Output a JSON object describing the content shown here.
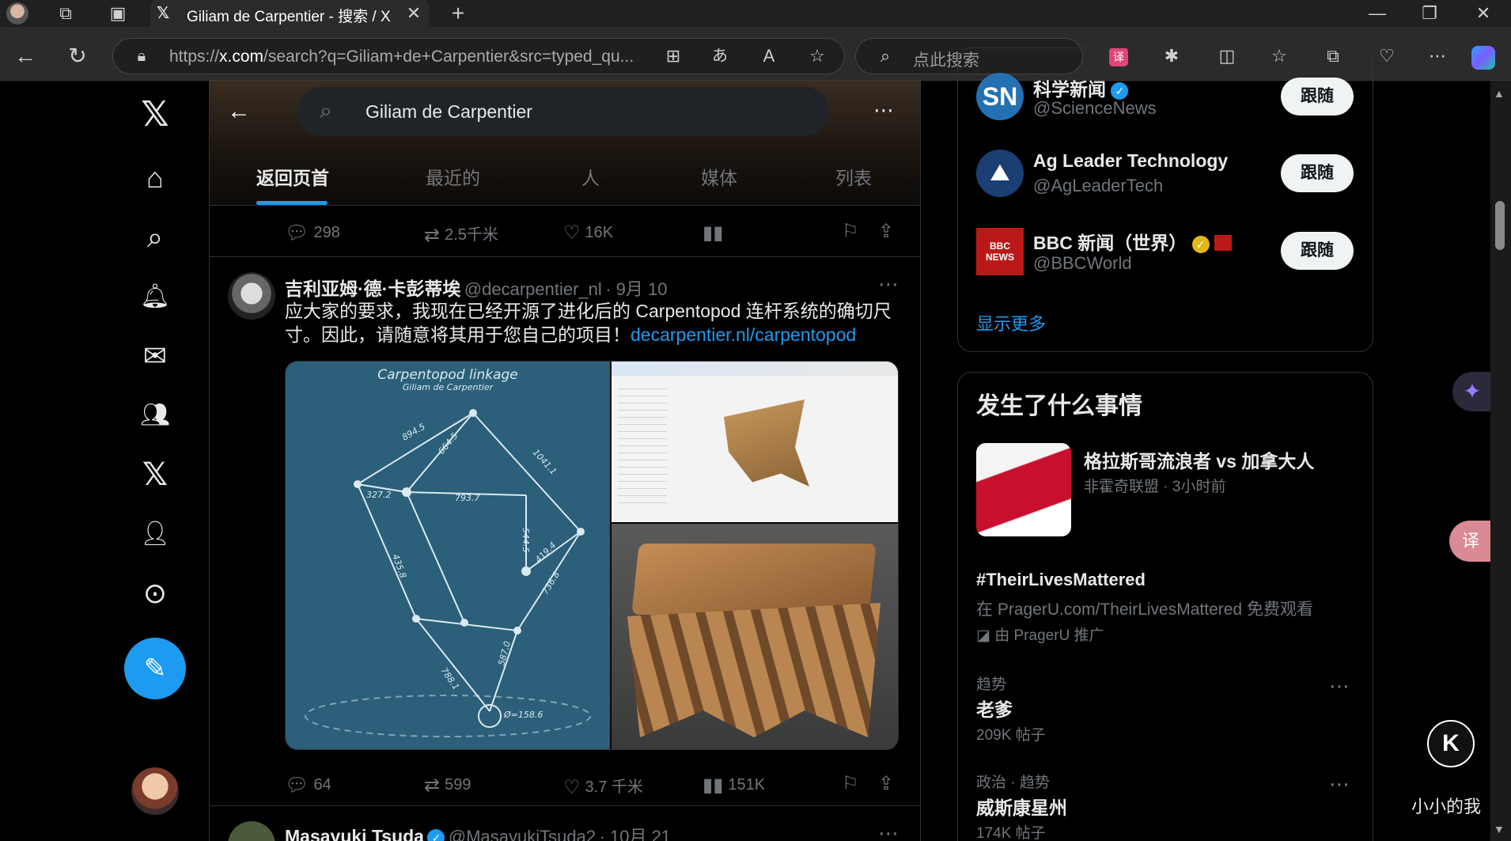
{
  "browser": {
    "tab_title": "Giliam de Carpentier - 搜索 / X",
    "url_host": "x.com",
    "url_prefix": "https://",
    "url_rest": "/search?q=Giliam+de+Carpentier&src=typed_qu...",
    "search_placeholder": "点此搜索"
  },
  "search": {
    "query": "Giliam de Carpentier",
    "tabs": [
      "返回页首",
      "最近的",
      "人",
      "媒体",
      "列表"
    ]
  },
  "prev_tweet_actions": {
    "replies": "298",
    "reposts": "2.5千米",
    "likes": "16K"
  },
  "tweet": {
    "name": "吉利亚姆·德·卡彭蒂埃",
    "handle": "@decarpentier_nl",
    "date": "· 9月 10",
    "text": "应大家的要求，我现在已经开源了进化后的 Carpentopod 连杆系统的确切尺寸。因此，请随意将其用于您自己的项目！",
    "link": "decarpentier.nl/carpentopod",
    "diagram_title": "Carpentopod linkage",
    "diagram_subtitle": "Giliam de Carpentier",
    "dims": [
      "894.5",
      "664.5",
      "1041.1",
      "327.2",
      "793.7",
      "544.5",
      "435.8",
      "419.4",
      "736.8",
      "788.1",
      "587.0",
      "Ø=158.6"
    ],
    "replies": "64",
    "reposts": "599",
    "likes": "3.7 千米",
    "views": "151K"
  },
  "next_tweet": {
    "name": "Masayuki Tsuda",
    "handle": "@MasayukiTsuda2",
    "date": "· 10月 21"
  },
  "who_to_follow": [
    {
      "name": "科学新闻",
      "handle": "@ScienceNews",
      "avatar_text": "SN",
      "button": "跟随"
    },
    {
      "name": "Ag Leader Technology",
      "handle": "@AgLeaderTech",
      "avatar_text": "",
      "button": "跟随"
    },
    {
      "name": "BBC 新闻（世界）",
      "handle": "@BBCWorld",
      "avatar_text": "BBC NEWS",
      "button": "跟随"
    }
  ],
  "show_more": "显示更多",
  "whats_happening": {
    "title": "发生了什么事情",
    "headline": "格拉斯哥流浪者 vs 加拿大人",
    "headline_meta": "非霍奇联盟 · 3小时前",
    "promo_title": "#TheirLivesMattered",
    "promo_text": "在 PragerU.com/TheirLivesMattered 免费观看",
    "promo_by": "由 PragerU 推广",
    "trends": [
      {
        "meta": "趋势",
        "title": "老爹",
        "count": "209K 帖子"
      },
      {
        "meta": "政治 · 趋势",
        "title": "威斯康星州",
        "count": "174K 帖子"
      }
    ]
  },
  "overlay_user": "小小的我",
  "colors": {
    "accent": "#1d9bf0",
    "background": "#000000",
    "border": "#2f3336"
  }
}
